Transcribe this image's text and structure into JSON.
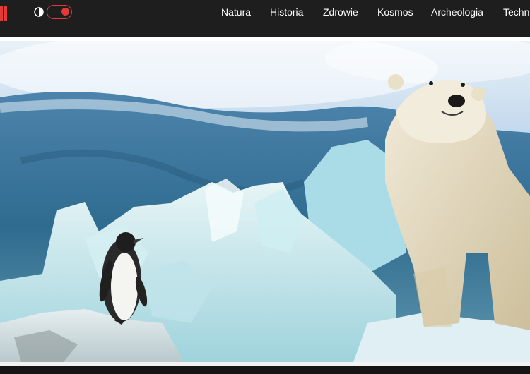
{
  "header": {
    "logo_icon": "logo-icon",
    "theme_icon": "contrast-icon",
    "toggle_state": "on",
    "accent": "#e53935",
    "background": "#1e1e1e"
  },
  "nav": {
    "items": [
      {
        "label": "Natura"
      },
      {
        "label": "Historia"
      },
      {
        "label": "Zdrowie"
      },
      {
        "label": "Kosmos"
      },
      {
        "label": "Archeologia"
      },
      {
        "label": "Techn"
      }
    ]
  },
  "hero": {
    "image_subject": "polar-bear-and-penguin-on-ice"
  }
}
